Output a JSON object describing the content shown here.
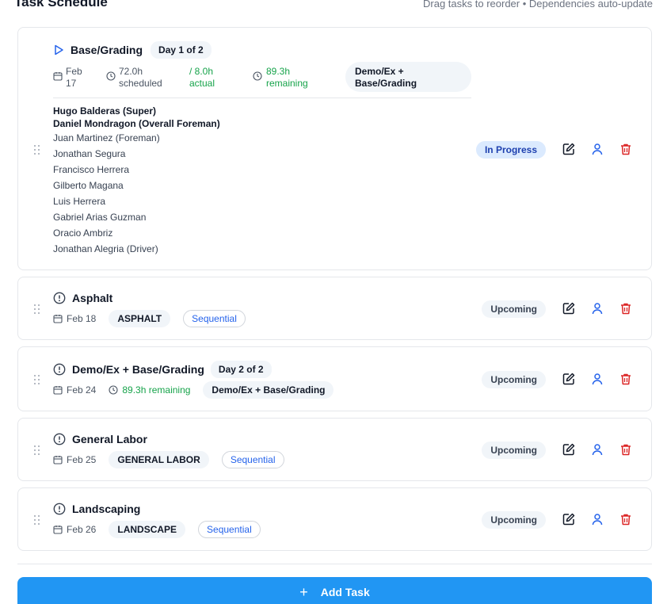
{
  "header": {
    "title": "Task Schedule",
    "hint": "Drag tasks to reorder • Dependencies auto-update"
  },
  "tasks": [
    {
      "title": "Base/Grading",
      "status_icon": "play-icon",
      "day_badge": "Day 1 of 2",
      "date_month": "Feb",
      "date_day": "17",
      "scheduled_value": "72.0h",
      "scheduled_label": "scheduled",
      "actual_value": "/ 8.0h",
      "actual_label": "actual",
      "remaining_value": "89.3h",
      "remaining_label": "remaining",
      "category_line1": "Demo/Ex +",
      "category_line2": "Base/Grading",
      "status": "In Progress",
      "crew_leads": [
        "Hugo Balderas (Super)",
        "Daniel Mondragon (Overall Foreman)"
      ],
      "crew_members": [
        "Juan Martinez (Foreman)",
        "Jonathan Segura",
        "Francisco Herrera",
        "Gilberto Magana",
        "Luis Herrera",
        "Gabriel Arias Guzman",
        "Oracio Ambriz",
        "Jonathan Alegria (Driver)"
      ]
    },
    {
      "title": "Asphalt",
      "status_icon": "alert-circle-icon",
      "date": "Feb 18",
      "category": "ASPHALT",
      "dependency": "Sequential",
      "status": "Upcoming"
    },
    {
      "title": "Demo/Ex + Base/Grading",
      "status_icon": "alert-circle-icon",
      "day_badge": "Day 2 of 2",
      "date": "Feb 24",
      "remaining": "89.3h remaining",
      "category": "Demo/Ex + Base/Grading",
      "status": "Upcoming"
    },
    {
      "title": "General Labor",
      "status_icon": "alert-circle-icon",
      "date": "Feb 25",
      "category": "GENERAL LABOR",
      "dependency": "Sequential",
      "status": "Upcoming"
    },
    {
      "title": "Landscaping",
      "status_icon": "alert-circle-icon",
      "date": "Feb 26",
      "category": "LANDSCAPE",
      "dependency": "Sequential",
      "status": "Upcoming"
    }
  ],
  "add_button": {
    "label": "Add Task",
    "icon": "plus-icon"
  },
  "colors": {
    "accent": "#2196f3",
    "in_progress_bg": "#dbeafe",
    "in_progress_text": "#1e40af",
    "remaining_green": "#16a34a",
    "edit_icon": "#111827",
    "assign_icon": "#2563eb",
    "delete_icon": "#dc2626"
  }
}
